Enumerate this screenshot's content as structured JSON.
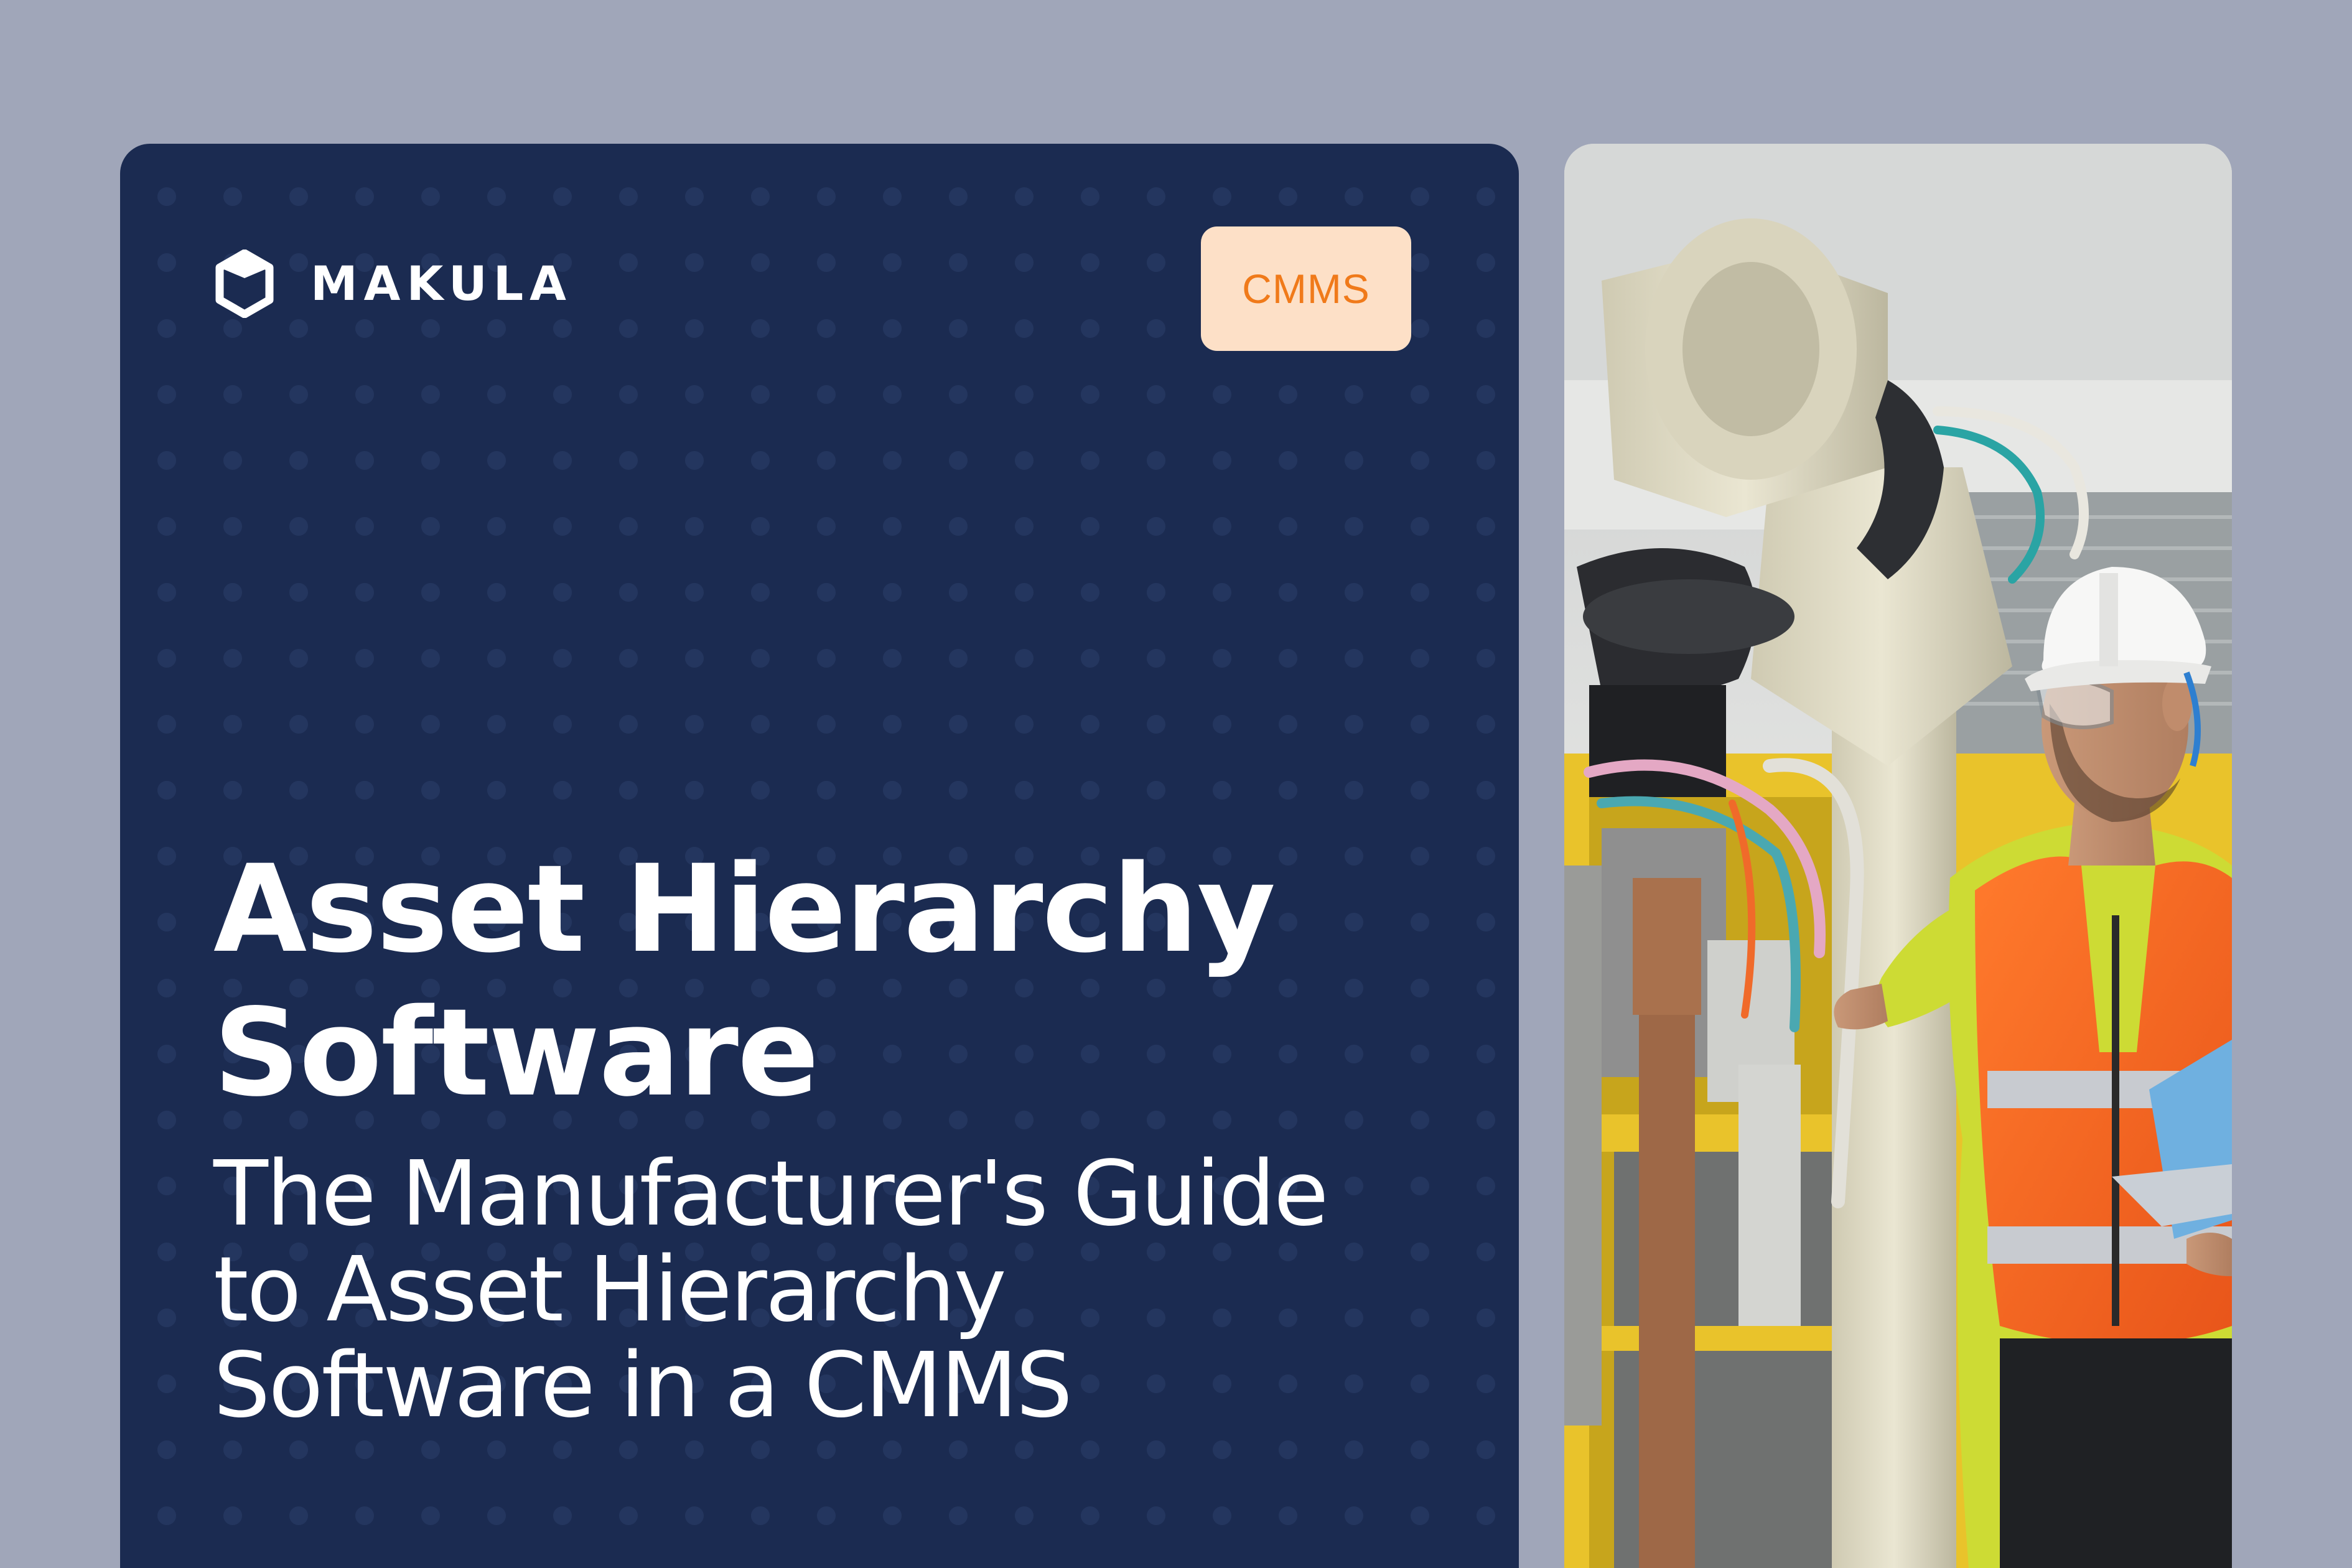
{
  "brand": {
    "name": "MAKULA",
    "logo_icon": "hexagon-logo-icon"
  },
  "badge": {
    "label": "CMMS",
    "text_color": "#f07a1a",
    "background": "#fde0c7"
  },
  "hero": {
    "title_line1": "Asset Hierarchy",
    "title_line2": "Software",
    "subtitle_line1": "The Manufacturer's Guide",
    "subtitle_line2": "to Asset Hierarchy",
    "subtitle_line3": "Software in a CMMS"
  },
  "photo": {
    "subject": "engineer-with-industrial-robot-photo"
  },
  "colors": {
    "page_background": "#a0a6b9",
    "card_background": "#1b2b51",
    "text": "#ffffff"
  }
}
